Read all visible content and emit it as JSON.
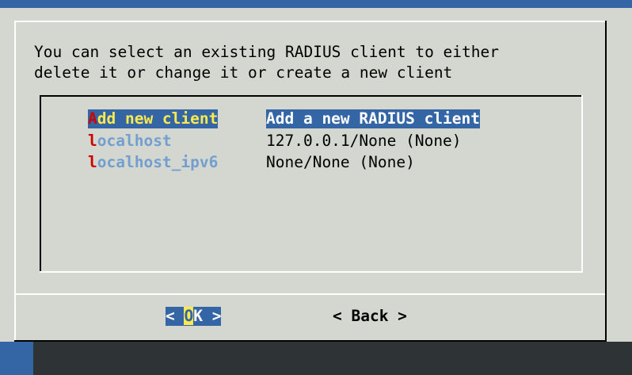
{
  "colors": {
    "background": "#3465a4",
    "dialog": "#d3d7cf",
    "selected_bg": "#3465a4",
    "selected_tag_fg": "#fce94f",
    "hotkey": "#cc0000",
    "tag_fg": "#729fcf"
  },
  "dialog": {
    "prompt_line1": "You can select an existing RADIUS client to either",
    "prompt_line2": "delete it or change it or create a new client"
  },
  "menu": {
    "items": [
      {
        "hotkey": "A",
        "tag_rest": "dd new client",
        "desc": "Add a new RADIUS client",
        "selected": true
      },
      {
        "hotkey": "l",
        "tag_rest": "ocalhost",
        "desc": "127.0.0.1/None (None)",
        "selected": false
      },
      {
        "hotkey": "l",
        "tag_rest": "ocalhost_ipv6",
        "desc": "None/None (None)",
        "selected": false
      }
    ]
  },
  "buttons": {
    "ok": {
      "prefix": "< ",
      "hotkey": "O",
      "rest": "K",
      "suffix": " >"
    },
    "back": {
      "label": "< Back >"
    }
  }
}
